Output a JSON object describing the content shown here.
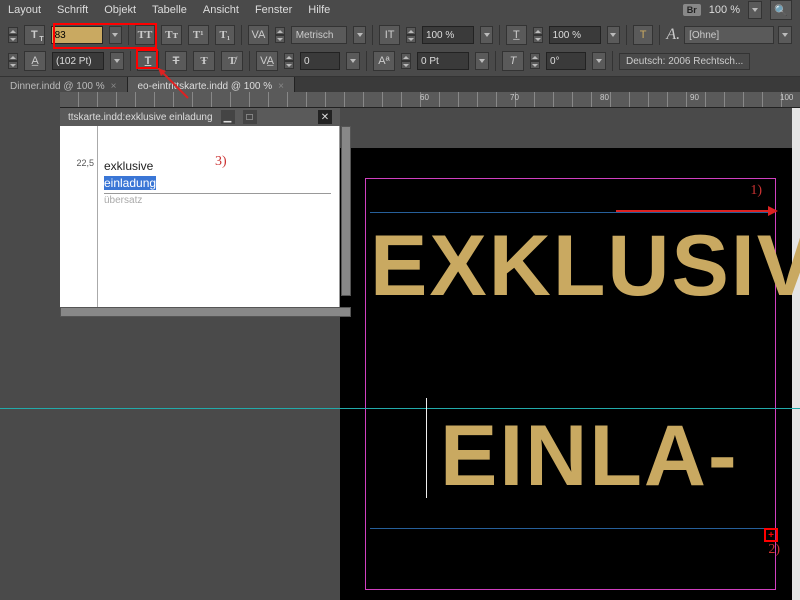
{
  "menu": {
    "items": [
      "Layout",
      "Schrift",
      "Objekt",
      "Tabelle",
      "Ansicht",
      "Fenster",
      "Hilfe"
    ],
    "br": "Br",
    "zoom": "100 %"
  },
  "toolbar": {
    "fontSizeLabel": "T",
    "fontSize": "83",
    "leading": "(102 Pt)",
    "kerning": "Metrisch",
    "tracking": "0",
    "vscale": "100 %",
    "hscale": "100 %",
    "baseline": "0 Pt",
    "skew": "0°",
    "charStyleLabel": "A.",
    "charStyle": "[Ohne]",
    "lang": "Deutsch: 2006 Rechtsch..."
  },
  "tabs": {
    "t1": "Dinner.indd @ 100 %",
    "t2": "eo-eintrittskarte.indd @ 100 %",
    "x": "×"
  },
  "story": {
    "title": "ttskarte.indd:exklusive einladung",
    "paraStyle": "22,5",
    "line1": "exklusive",
    "line2": "einladung",
    "overset": "übersatz"
  },
  "annotations": {
    "a1": "1)",
    "a2": "2)",
    "a3": "3)"
  },
  "canvas": {
    "line1": "EXKLUSIVE",
    "line2": "EINLA-"
  },
  "overflow": "+",
  "ruler": {
    "n1": "60",
    "n2": "70",
    "n3": "80",
    "n4": "90",
    "n5": "100"
  }
}
